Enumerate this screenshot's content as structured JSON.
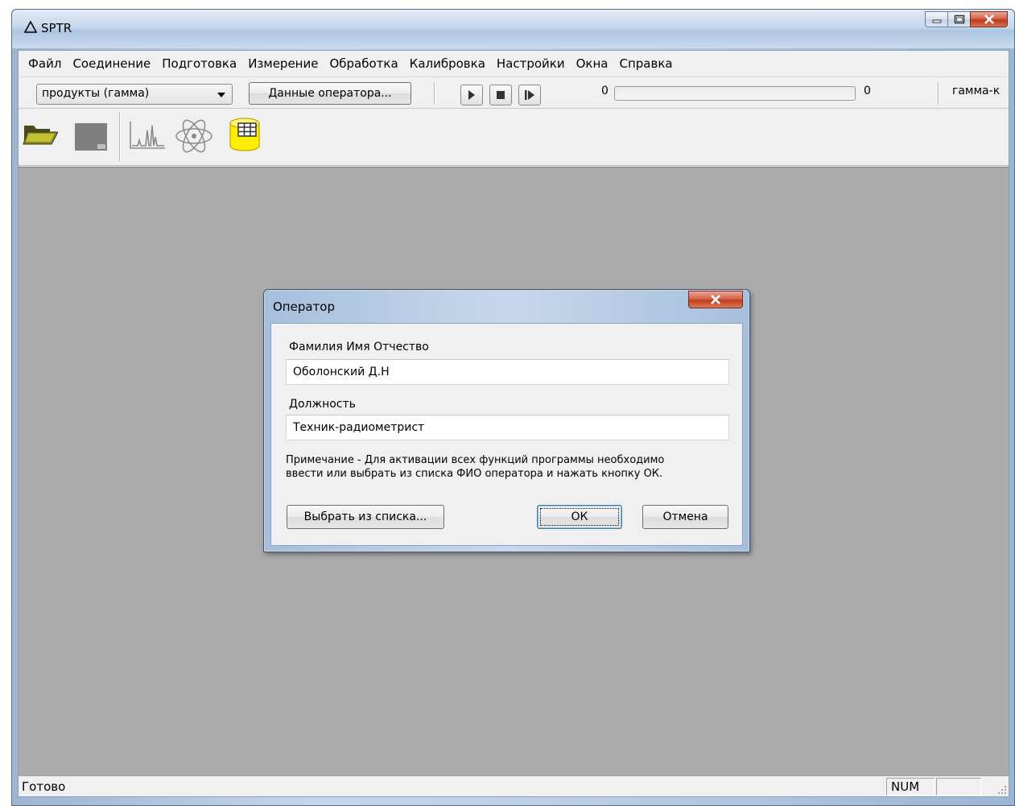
{
  "window": {
    "title": "SPTR",
    "icon": "delta-triangle-icon"
  },
  "menu": [
    "Файл",
    "Соединение",
    "Подготовка",
    "Измерение",
    "Обработка",
    "Калибровка",
    "Настройки",
    "Окна",
    "Справка"
  ],
  "toolbar": {
    "profile_selected": "продукты (гамма)",
    "operator_button": "Данные оператора...",
    "counter_left": "0",
    "counter_right": "0",
    "progress": 0,
    "detector_label": "гамма-к"
  },
  "tools": [
    "open-folder-icon",
    "save-disk-icon",
    "spectrum-icon",
    "atom-icon",
    "database-table-icon"
  ],
  "status": {
    "text": "Готово",
    "num_indicator": "NUM"
  },
  "dialog": {
    "title": "Оператор",
    "name_label": "Фамилия Имя Отчество",
    "name_value": "Оболонский Д.Н",
    "position_label": "Должность",
    "position_value": "Техник-радиометрист",
    "note_line1": "Примечание - Для активации всех функций программы необходимо",
    "note_line2": "ввести или выбрать из списка ФИО оператора и нажать кнопку ОК.",
    "choose_button": "Выбрать из списка...",
    "ok_button": "ОК",
    "cancel_button": "Отмена"
  },
  "colors": {
    "workspace": "#ababab",
    "db_icon": "#ffee00",
    "close_button": "#c7432a"
  }
}
